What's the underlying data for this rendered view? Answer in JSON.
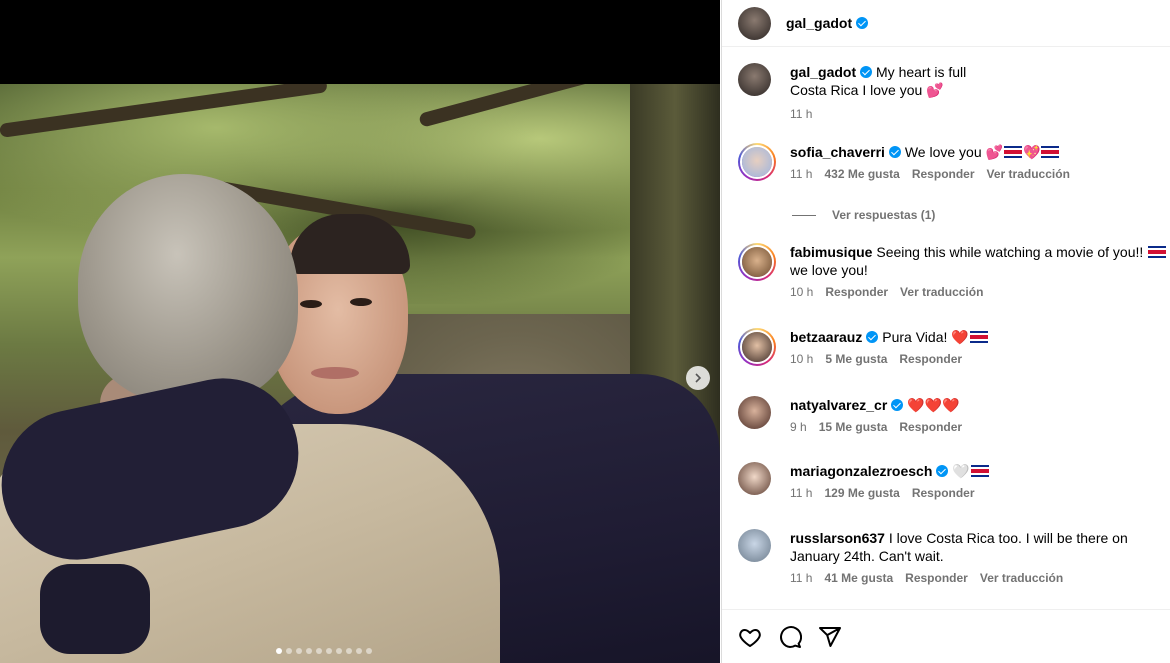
{
  "post_author": {
    "username": "gal_gadot",
    "verified": true
  },
  "caption": {
    "username": "gal_gadot",
    "line1": "My heart is full",
    "line2": "Costa Rica I love you",
    "emoji": "💕",
    "time": "11 h"
  },
  "carousel": {
    "total_slides": 10,
    "current_index": 1
  },
  "comments": [
    {
      "username": "sofia_chaverri",
      "verified": true,
      "text": "We love you 💕",
      "suffix": "💖",
      "time": "11 h",
      "likes": "432 Me gusta",
      "reply": "Responder",
      "translate": "Ver traducción"
    },
    {
      "username": "fabimusique",
      "verified": false,
      "text": "Seeing this while watching a movie of you!! ",
      "text2": " we love you!",
      "time": "10 h",
      "reply": "Responder",
      "translate": "Ver traducción"
    },
    {
      "username": "betzaarauz",
      "verified": true,
      "text": "Pura Vida! ❤️",
      "time": "10 h",
      "likes": "5 Me gusta",
      "reply": "Responder"
    },
    {
      "username": "natyalvarez_cr",
      "verified": true,
      "text": "❤️❤️❤️",
      "time": "9 h",
      "likes": "15 Me gusta",
      "reply": "Responder"
    },
    {
      "username": "mariagonzalezroesch",
      "verified": true,
      "text": "🤍",
      "time": "11 h",
      "likes": "129 Me gusta",
      "reply": "Responder"
    },
    {
      "username": "russlarson637",
      "verified": false,
      "text": "I love Costa Rica too. I will be there on January 24th. Can't wait.",
      "time": "11 h",
      "likes": "41 Me gusta",
      "reply": "Responder",
      "translate": "Ver traducción"
    }
  ],
  "view_replies": "Ver respuestas (1)",
  "icons": {
    "like": "heart-icon",
    "comment": "comment-icon",
    "share": "share-icon",
    "next": "chevron-right-icon"
  },
  "colors": {
    "verified": "#0095f6",
    "meta": "#737373",
    "border": "#dbdbdb"
  }
}
